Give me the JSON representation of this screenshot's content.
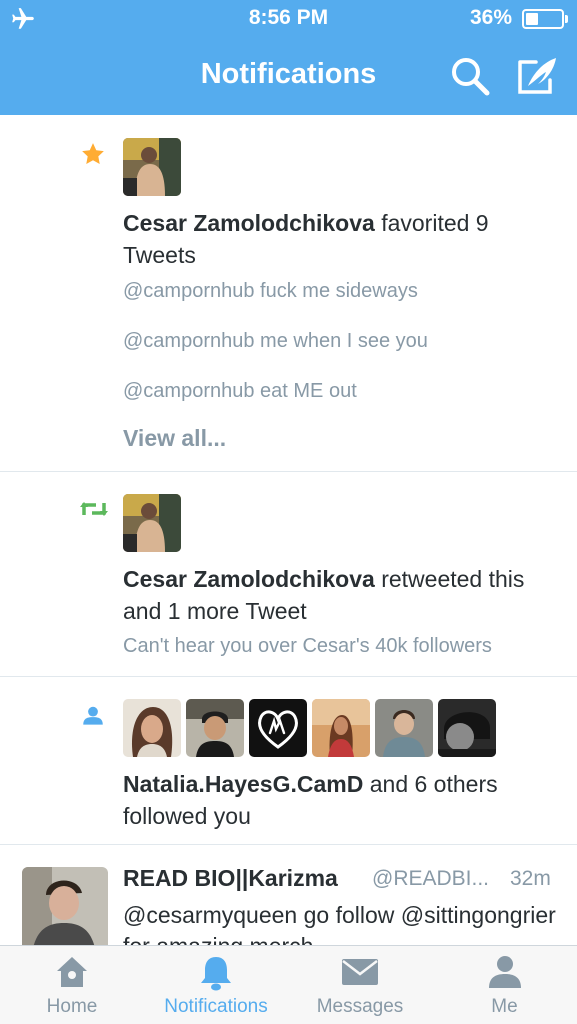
{
  "status_bar": {
    "time": "8:56 PM",
    "battery": "36%",
    "battery_level": 0.36
  },
  "header": {
    "title": "Notifications"
  },
  "notifications": [
    {
      "type": "favorite",
      "actor": "Cesar Zamolodchikova",
      "action": " favorited 9 Tweets",
      "tweets": [
        "@campornhub fuck me sideways",
        "@campornhub me when I see you",
        "@campornhub eat ME out"
      ],
      "view_all": "View all..."
    },
    {
      "type": "retweet",
      "actor": "Cesar Zamolodchikova",
      "action": " retweeted this and 1 more Tweet",
      "tweet": "Can't hear you over Cesar's 40k followers"
    },
    {
      "type": "follow",
      "actor": "Natalia.HayesG.CamD",
      "action": " and 6 others followed you"
    }
  ],
  "tweet": {
    "name": "READ BIO||Karizma",
    "handle": "@READBI...",
    "time": "32m",
    "text": "@cesarmyqueen go follow @sittingongrier for amazing merch"
  },
  "tabbar": {
    "tabs": [
      {
        "label": "Home",
        "icon": "home-icon"
      },
      {
        "label": "Notifications",
        "icon": "bell-icon",
        "active": true
      },
      {
        "label": "Messages",
        "icon": "envelope-icon"
      },
      {
        "label": "Me",
        "icon": "person-icon"
      }
    ]
  },
  "colors": {
    "brand": "#55acee",
    "favorite": "#ffac33",
    "retweet": "#5cb85c",
    "muted": "#8899a6"
  }
}
